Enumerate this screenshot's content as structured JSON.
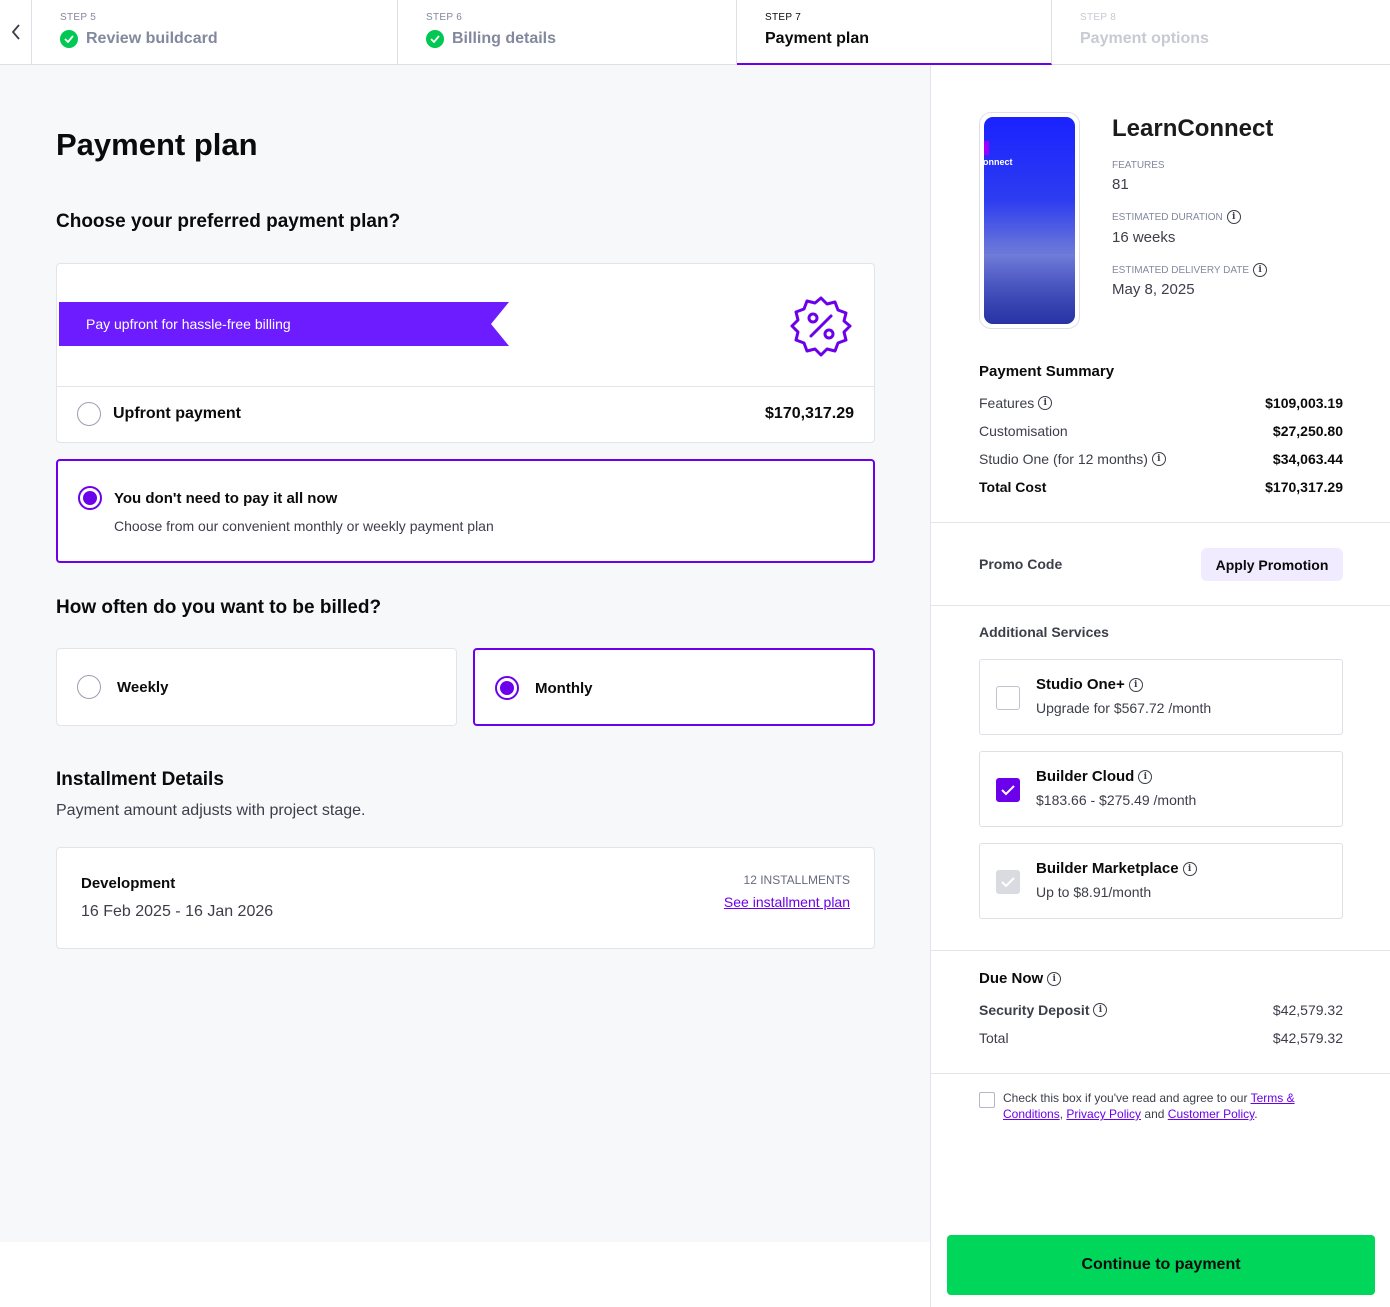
{
  "stepper": {
    "steps": [
      {
        "num": "STEP 5",
        "name": "Review buildcard"
      },
      {
        "num": "STEP 6",
        "name": "Billing details"
      },
      {
        "num": "STEP 7",
        "name": "Payment plan"
      },
      {
        "num": "STEP 8",
        "name": "Payment options"
      }
    ]
  },
  "main": {
    "title": "Payment plan",
    "plan_question": "Choose your preferred payment plan?",
    "ribbon": "Pay upfront for hassle-free billing",
    "upfront": {
      "label": "Upfront payment",
      "amount": "$170,317.29",
      "selected": false
    },
    "installment": {
      "label": "You don't need to pay it all now",
      "sub": "Choose from our convenient monthly or weekly payment plan",
      "selected": true
    },
    "billing_question": "How often do you want to be billed?",
    "frequency": [
      {
        "label": "Weekly",
        "selected": false
      },
      {
        "label": "Monthly",
        "selected": true
      }
    ],
    "installment_details": {
      "title": "Installment Details",
      "sub": "Payment amount adjusts with project stage.",
      "stage": "Development",
      "dates": "16 Feb 2025 - 16 Jan 2026",
      "count": "12 INSTALLMENTS",
      "link": "See installment plan"
    }
  },
  "side": {
    "app_name": "LearnConnect",
    "thumb_text": "onnect",
    "features_label": "FEATURES",
    "features_value": "81",
    "duration_label": "ESTIMATED DURATION",
    "duration_value": "16 weeks",
    "delivery_label": "ESTIMATED DELIVERY DATE",
    "delivery_value": "May 8, 2025",
    "summary_title": "Payment Summary",
    "summary": [
      {
        "label": "Features",
        "value": "$109,003.19"
      },
      {
        "label": "Customisation",
        "value": "$27,250.80"
      },
      {
        "label": "Studio One (for 12 months)",
        "value": "$34,063.44"
      },
      {
        "label": "Total Cost",
        "value": "$170,317.29"
      }
    ],
    "promo_label": "Promo Code",
    "promo_button": "Apply Promotion",
    "services_title": "Additional Services",
    "services": [
      {
        "title": "Studio One+",
        "sub": "Upgrade for $567.72 /month",
        "checked": false
      },
      {
        "title": "Builder Cloud",
        "sub": "$183.66 - $275.49 /month",
        "checked": true
      },
      {
        "title": "Builder Marketplace",
        "sub": "Up to $8.91/month",
        "checked": true
      }
    ],
    "due_title": "Due Now",
    "deposit_label": "Security Deposit",
    "deposit_value": "$42,579.32",
    "total_label": "Total",
    "total_value": "$42,579.32",
    "terms_prefix": "Check this box if you've read and agree to our",
    "terms_link": "Terms & Conditions",
    "privacy_link": "Privacy Policy",
    "and_text": "and",
    "customer_link": "Customer Policy",
    "cta": "Continue to payment"
  },
  "colors": {
    "accent": "#6c00ea",
    "ribbon": "#6c1cff",
    "success": "#00c853",
    "cta": "#00d659"
  },
  "icons": [
    "chevron-left-icon",
    "check-circle-icon",
    "discount-badge-icon",
    "info-icon",
    "checkmark-icon"
  ]
}
